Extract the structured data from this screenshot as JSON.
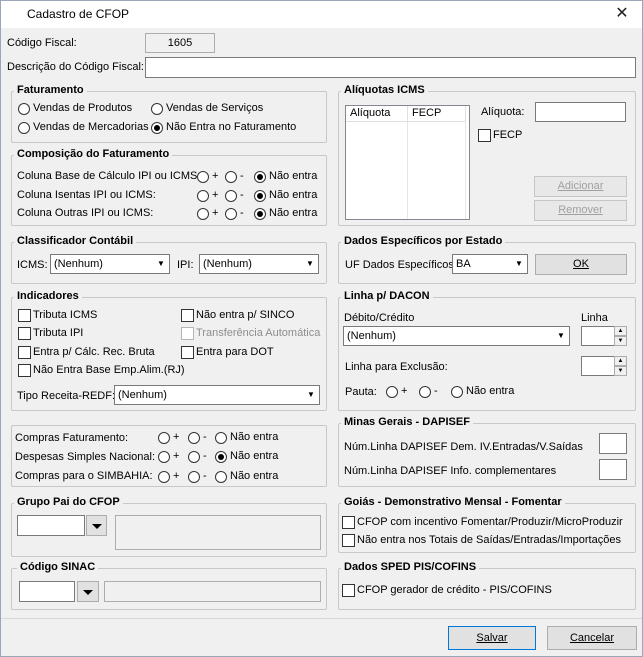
{
  "window": {
    "title": "Cadastro de CFOP",
    "close_glyph": "✕"
  },
  "codigo_fiscal": {
    "label": "Código Fiscal:",
    "value": "1605"
  },
  "descricao": {
    "label": "Descrição do Código Fiscal:",
    "value": ""
  },
  "faturamento": {
    "title": "Faturamento",
    "options": [
      "Vendas de Produtos",
      "Vendas de Serviços",
      "Vendas de Mercadorias",
      "Não Entra no Faturamento"
    ],
    "selected": "Não Entra no Faturamento"
  },
  "composicao": {
    "title": "Composição do Faturamento",
    "rows": [
      {
        "label": "Coluna Base de Cálculo IPI ou ICMS:",
        "selected": "Não entra"
      },
      {
        "label": "Coluna Isentas IPI ou ICMS:",
        "selected": "Não entra"
      },
      {
        "label": "Coluna Outras IPI ou ICMS:",
        "selected": "Não entra"
      }
    ],
    "opt_plus": "+",
    "opt_minus": "-",
    "opt_none": "Não entra"
  },
  "aliquotas": {
    "title": "Alíquotas ICMS",
    "columns": [
      "Alíquota",
      "FECP"
    ],
    "rows": [],
    "aliquota_label": "Alíquota:",
    "aliquota_value": "",
    "fecp_label": "FECP",
    "fecp_checked": false,
    "adicionar": "Adicionar",
    "remover": "Remover"
  },
  "classificador": {
    "title": "Classificador Contábil",
    "icms_label": "ICMS:",
    "icms_value": "(Nenhum)",
    "ipi_label": "IPI:",
    "ipi_value": "(Nenhum)"
  },
  "dados_estado": {
    "title": "Dados Específicos por Estado",
    "uf_label": "UF Dados Específicos:",
    "uf_value": "BA",
    "ok": "OK"
  },
  "indicadores": {
    "title": "Indicadores",
    "checks": [
      {
        "label": "Tributa ICMS",
        "checked": false,
        "enabled": true
      },
      {
        "label": "Não entra p/ SINCO",
        "checked": false,
        "enabled": true
      },
      {
        "label": "Tributa IPI",
        "checked": false,
        "enabled": true
      },
      {
        "label": "Transferência Automática",
        "checked": false,
        "enabled": false
      },
      {
        "label": "Entra p/ Cálc. Rec. Bruta",
        "checked": false,
        "enabled": true
      },
      {
        "label": "Entra para DOT",
        "checked": false,
        "enabled": true
      },
      {
        "label": "Não Entra Base Emp.Alim.(RJ)",
        "checked": false,
        "enabled": true
      }
    ],
    "redf_label": "Tipo Receita-REDF:",
    "redf_value": "(Nenhum)"
  },
  "dacon": {
    "title": "Linha p/ DACON",
    "debito_label": "Débito/Crédito",
    "debito_value": "(Nenhum)",
    "linha_label": "Linha",
    "linha_value": "",
    "exclusao_label": "Linha para Exclusão:",
    "exclusao_value": "",
    "pauta_label": "Pauta:",
    "pauta_selected": "Não entra",
    "opt_plus": "+",
    "opt_minus": "-",
    "opt_none": "Não entra"
  },
  "compras": {
    "rows": [
      {
        "label": "Compras Faturamento:",
        "selected": "Não entra"
      },
      {
        "label": "Despesas Simples Nacional:",
        "selected": "Não entra"
      },
      {
        "label": "Compras para o SIMBAHIA:",
        "selected": "Não entra"
      }
    ],
    "opt_plus": "+",
    "opt_minus": "-",
    "opt_none": "Não entra"
  },
  "minas": {
    "title": "Minas Gerais - DAPISEF",
    "dem_label": "Núm.Linha DAPISEF Dem. IV.Entradas/V.Saídas",
    "dem_value": "",
    "info_label": "Núm.Linha DAPISEF Info. complementares",
    "info_value": ""
  },
  "grupo_pai": {
    "title": "Grupo Pai do CFOP",
    "value": "",
    "desc": ""
  },
  "goias": {
    "title": "Goiás - Demonstrativo Mensal - Fomentar",
    "check1": "CFOP com incentivo  Fomentar/Produzir/MicroProduzir",
    "check2": "Não entra nos Totais de  Saídas/Entradas/Importações"
  },
  "sinac": {
    "title": "Código SINAC",
    "value": "",
    "desc": ""
  },
  "sped": {
    "title": "Dados SPED PIS/COFINS",
    "check": "CFOP gerador de crédito - PIS/COFINS"
  },
  "footer": {
    "salvar": "Salvar",
    "cancelar": "Cancelar"
  }
}
